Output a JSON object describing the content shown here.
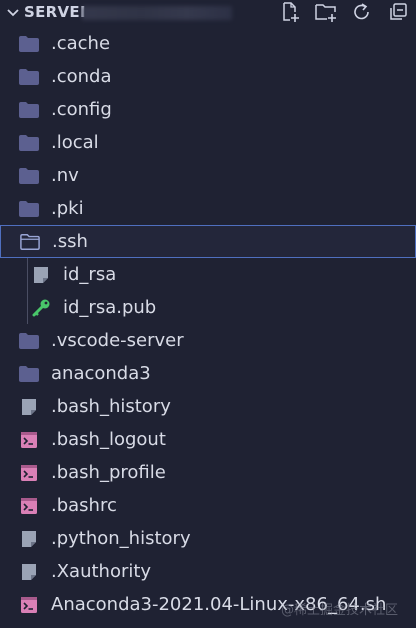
{
  "header": {
    "title": "SERVEI"
  },
  "colors": {
    "background": "#1f2233",
    "folder": "#5c6090",
    "file_generic": "#9aa3b5",
    "terminal_file": "#d980b6",
    "key": "#49c66a",
    "selection_border": "#4f6fbf"
  },
  "toolbar": {
    "new_file_icon": "new-file-icon",
    "new_folder_icon": "new-folder-icon",
    "refresh_icon": "refresh-icon",
    "collapse_icon": "collapse-all-icon"
  },
  "tree": {
    "items": [
      {
        "label": ".cache",
        "type": "folder"
      },
      {
        "label": ".conda",
        "type": "folder"
      },
      {
        "label": ".config",
        "type": "folder"
      },
      {
        "label": ".local",
        "type": "folder"
      },
      {
        "label": ".nv",
        "type": "folder"
      },
      {
        "label": ".pki",
        "type": "folder"
      },
      {
        "label": ".ssh",
        "type": "folder-open",
        "selected": true
      },
      {
        "label": "id_rsa",
        "type": "file"
      },
      {
        "label": "id_rsa.pub",
        "type": "key"
      },
      {
        "label": ".vscode-server",
        "type": "folder"
      },
      {
        "label": "anaconda3",
        "type": "folder"
      },
      {
        "label": ".bash_history",
        "type": "file"
      },
      {
        "label": ".bash_logout",
        "type": "terminal"
      },
      {
        "label": ".bash_profile",
        "type": "terminal"
      },
      {
        "label": ".bashrc",
        "type": "terminal"
      },
      {
        "label": ".python_history",
        "type": "file"
      },
      {
        "label": ".Xauthority",
        "type": "file"
      },
      {
        "label": "Anaconda3-2021.04-Linux-x86_64.sh",
        "type": "terminal"
      }
    ]
  },
  "watermark": "@稀土掘金技术社区"
}
